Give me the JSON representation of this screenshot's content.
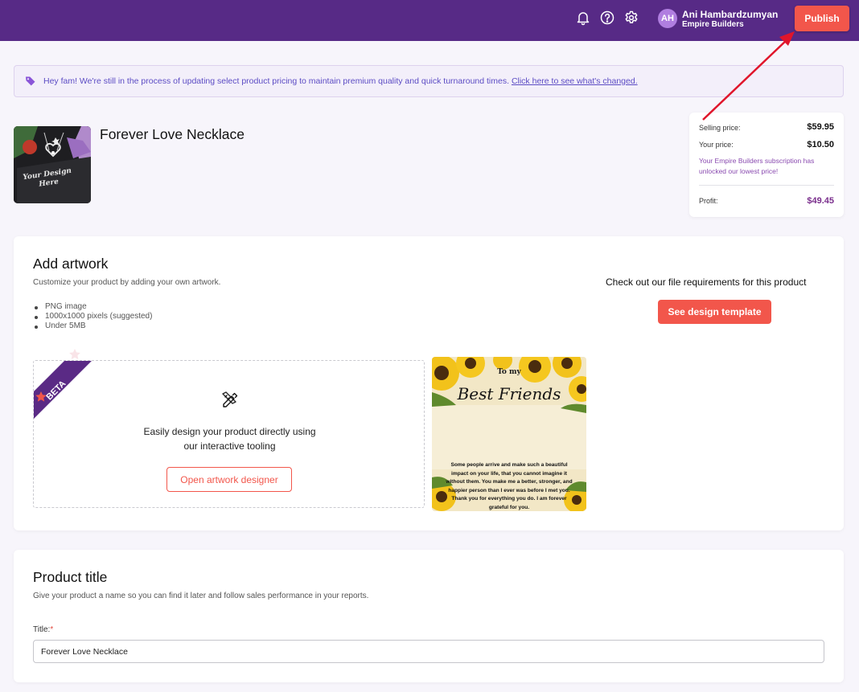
{
  "header": {
    "icons": [
      "bell-icon",
      "help-icon",
      "gear-icon"
    ],
    "avatar_initials": "AH",
    "user_name": "Ani Hambardzumyan",
    "user_org": "Empire Builders",
    "publish_label": "Publish"
  },
  "notice": {
    "icon": "tag-icon",
    "text": "Hey fam! We're still in the process of updating select product pricing to maintain premium quality and quick turnaround times. ",
    "link_text": "Click here to see what's changed."
  },
  "product": {
    "title": "Forever Love Necklace",
    "thumb_lines": [
      "Your Design",
      "Here"
    ]
  },
  "pricing": {
    "selling_label": "Selling price:",
    "selling_value": "$59.95",
    "your_label": "Your price:",
    "your_value": "$10.50",
    "note": "Your Empire Builders subscription has unlocked our lowest price!",
    "profit_label": "Profit:",
    "profit_value": "$49.45"
  },
  "artwork": {
    "title": "Add artwork",
    "subtitle": "Customize your product by adding your own artwork.",
    "requirements": [
      "PNG image",
      "1000x1000 pixels (suggested)",
      "Under 5MB"
    ],
    "file_req_text": "Check out our file requirements for this product",
    "template_button": "See design template",
    "beta_label": "BETA",
    "designer_text_1": "Easily design your product directly using",
    "designer_text_2": "our interactive tooling",
    "designer_button": "Open artwork designer",
    "preview": {
      "small_text": "To my",
      "script_title": "Best Friends",
      "message": "Some people arrive and make such a beautiful impact on your life, that you cannot imagine it without them. You make me a better, stronger, and happier person than I ever was before I met you. Thank you for everything you do. I am forever grateful for you."
    }
  },
  "product_title_section": {
    "title": "Product title",
    "subtitle": "Give your product a name so you can find it later and follow sales performance in your reports.",
    "field_label": "Title:",
    "required_mark": "*",
    "input_value": "Forever Love Necklace"
  },
  "colors": {
    "topbar": "#572a86",
    "accent": "#f2564b",
    "notice_text": "#5c4cc4",
    "annotation_arrow": "#e0152b"
  }
}
